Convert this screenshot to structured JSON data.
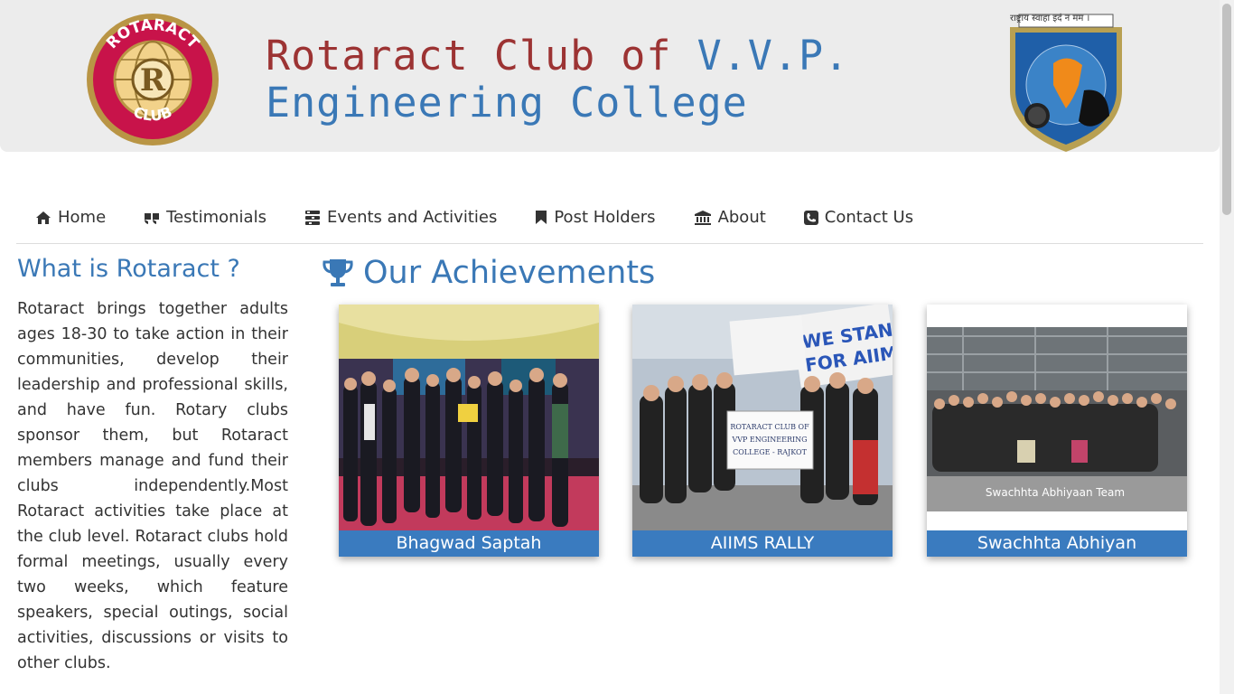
{
  "header": {
    "title_part1": "Rotaract Club of ",
    "title_part2": "V.V.P.",
    "title_line2": "Engineering College",
    "left_logo_top_text": "ROTARACT",
    "left_logo_bottom_text": "CLUB",
    "right_logo_motto": "राष्ट्राय स्वाहा इदं न मम ।"
  },
  "nav": {
    "items": [
      {
        "label": "Home",
        "icon": "home-icon"
      },
      {
        "label": "Testimonials",
        "icon": "quote-icon"
      },
      {
        "label": "Events and Activities",
        "icon": "tasks-icon"
      },
      {
        "label": "Post Holders",
        "icon": "bookmark-icon"
      },
      {
        "label": "About",
        "icon": "bank-icon"
      },
      {
        "label": "Contact Us",
        "icon": "phone-icon"
      }
    ]
  },
  "sidebar": {
    "title": "What is Rotaract ?",
    "body": "Rotaract brings together adults ages 18-30 to take action in their communities, develop their leadership and professional skills, and have fun. Rotary clubs sponsor them, but Rotaract members manage and fund their clubs independently.Most Rotaract activities take place at the club level. Rotaract clubs hold formal meetings, usually every two weeks, which feature speakers, special outings, social activities, discussions or visits to other clubs."
  },
  "achievements": {
    "title": "Our Achievements",
    "cards": [
      {
        "caption": "Bhagwad Saptah"
      },
      {
        "caption": "AIIMS RALLY",
        "banner_text": "ROTARACT CLUB OF VVP ENGINEERING COLLEGE - RAJKOT",
        "sign_text": "WE STAND FOR AIIMS"
      },
      {
        "caption": "Swachhta Abhiyan",
        "photo_text": "Swachhta Abhiyaan Team"
      }
    ]
  },
  "colors": {
    "accent": "#3a78b6",
    "title_red": "#9c3333",
    "caption_bg": "#3a7bbf",
    "header_bg": "#ececec"
  }
}
